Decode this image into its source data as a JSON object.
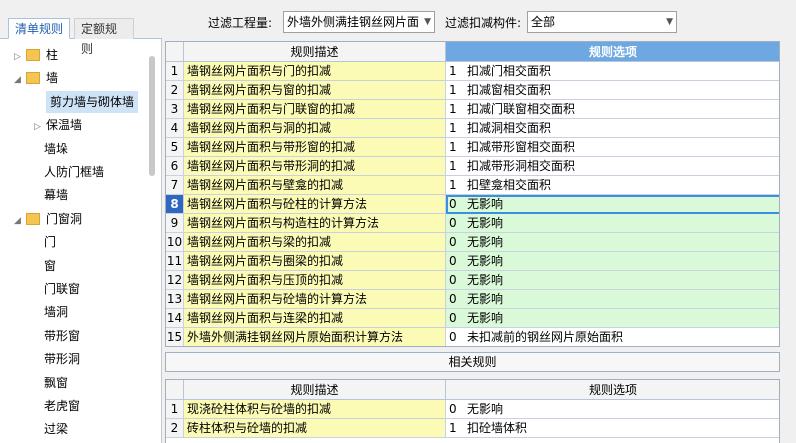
{
  "tabs": [
    "清单规则",
    "定额规则"
  ],
  "tree": [
    {
      "label": "柱",
      "level": 0,
      "folder": true,
      "arrow": "▷"
    },
    {
      "label": "墙",
      "level": 0,
      "folder": true,
      "arrow": "◢"
    },
    {
      "label": "剪力墙与砌体墙",
      "level": 1,
      "selected": true
    },
    {
      "label": "保温墙",
      "level": 1,
      "arrow": "▷"
    },
    {
      "label": "墙垛",
      "level": 1
    },
    {
      "label": "人防门框墙",
      "level": 1
    },
    {
      "label": "幕墙",
      "level": 1
    },
    {
      "label": "门窗洞",
      "level": 0,
      "folder": true,
      "arrow": "◢"
    },
    {
      "label": "门",
      "level": 1
    },
    {
      "label": "窗",
      "level": 1
    },
    {
      "label": "门联窗",
      "level": 1
    },
    {
      "label": "墙洞",
      "level": 1
    },
    {
      "label": "带形窗",
      "level": 1
    },
    {
      "label": "带形洞",
      "level": 1
    },
    {
      "label": "飘窗",
      "level": 1
    },
    {
      "label": "老虎窗",
      "level": 1
    },
    {
      "label": "过梁",
      "level": 1
    }
  ],
  "filter": {
    "qty_label": "过滤工程量:",
    "qty_value": "外墙外侧满挂钢丝网片面",
    "comp_label": "过滤扣减构件:",
    "comp_value": "全部"
  },
  "main_grid": {
    "headers": [
      "规则描述",
      "规则选项"
    ],
    "rows": [
      {
        "n": "1",
        "desc": "墙钢丝网片面积与门的扣减",
        "code": "1",
        "opt": "扣减门相交面积"
      },
      {
        "n": "2",
        "desc": "墙钢丝网片面积与窗的扣减",
        "code": "1",
        "opt": "扣减窗相交面积"
      },
      {
        "n": "3",
        "desc": "墙钢丝网片面积与门联窗的扣减",
        "code": "1",
        "opt": "扣减门联窗相交面积"
      },
      {
        "n": "4",
        "desc": "墙钢丝网片面积与洞的扣减",
        "code": "1",
        "opt": "扣减洞相交面积"
      },
      {
        "n": "5",
        "desc": "墙钢丝网片面积与带形窗的扣减",
        "code": "1",
        "opt": "扣减带形窗相交面积"
      },
      {
        "n": "6",
        "desc": "墙钢丝网片面积与带形洞的扣减",
        "code": "1",
        "opt": "扣减带形洞相交面积"
      },
      {
        "n": "7",
        "desc": "墙钢丝网片面积与壁龛的扣减",
        "code": "1",
        "opt": "扣壁龛相交面积"
      },
      {
        "n": "8",
        "desc": "墙钢丝网片面积与砼柱的计算方法",
        "code": "0",
        "opt": "无影响"
      },
      {
        "n": "9",
        "desc": "墙钢丝网片面积与构造柱的计算方法",
        "code": "0",
        "opt": "无影响"
      },
      {
        "n": "10",
        "desc": "墙钢丝网片面积与梁的扣减",
        "code": "0",
        "opt": "无影响"
      },
      {
        "n": "11",
        "desc": "墙钢丝网片面积与圈梁的扣减",
        "code": "0",
        "opt": "无影响"
      },
      {
        "n": "12",
        "desc": "墙钢丝网片面积与压顶的扣减",
        "code": "0",
        "opt": "无影响"
      },
      {
        "n": "13",
        "desc": "墙钢丝网片面积与砼墙的计算方法",
        "code": "0",
        "opt": "无影响"
      },
      {
        "n": "14",
        "desc": "墙钢丝网片面积与连梁的扣减",
        "code": "0",
        "opt": "无影响"
      },
      {
        "n": "15",
        "desc": "外墙外侧满挂钢丝网片原始面积计算方法",
        "code": "0",
        "opt": "未扣减前的钢丝网片原始面积"
      }
    ]
  },
  "related_label": "相关规则",
  "related_grid": {
    "headers": [
      "规则描述",
      "规则选项"
    ],
    "rows": [
      {
        "n": "1",
        "desc": "现浇砼柱体积与砼墙的扣减",
        "code": "0",
        "opt": "无影响"
      },
      {
        "n": "2",
        "desc": "砖柱体积与砼墙的扣减",
        "code": "1",
        "opt": "扣砼墙体积"
      }
    ]
  }
}
